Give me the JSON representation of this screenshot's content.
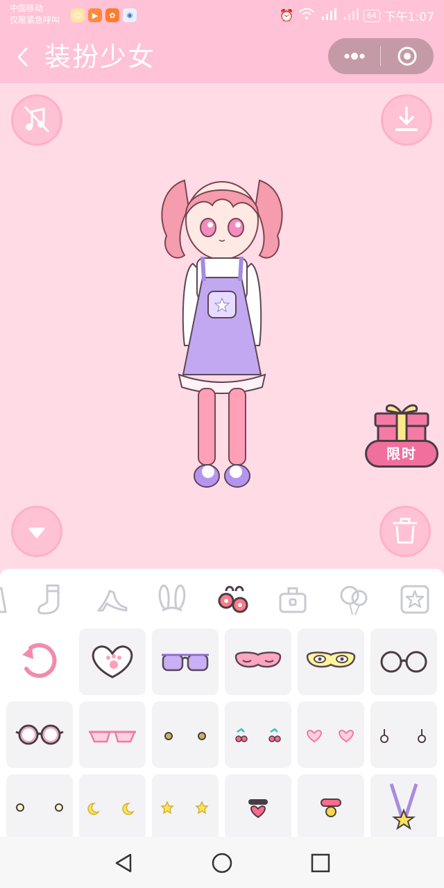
{
  "status_bar": {
    "carrier_line1": "中国移动",
    "carrier_line2": "仅限紧急呼叫",
    "battery": "64",
    "time": "下午1:07",
    "icons": [
      "alarm-icon",
      "wifi-icon",
      "signal-4g-icon",
      "signal-icon",
      "battery-icon"
    ]
  },
  "nav": {
    "title": "装扮少女",
    "back_icon": "chevron-left-icon",
    "more_icon": "more-dots-icon",
    "close_icon": "target-icon"
  },
  "stage": {
    "music_icon": "music-off-icon",
    "download_icon": "download-icon",
    "collapse_icon": "triangle-down-icon",
    "trash_icon": "trash-icon",
    "gift_label": "限时"
  },
  "categories": [
    {
      "icon": "dress-icon",
      "selected": false
    },
    {
      "icon": "sock-icon",
      "selected": false
    },
    {
      "icon": "high-heel-icon",
      "selected": false
    },
    {
      "icon": "bunny-ears-icon",
      "selected": false
    },
    {
      "icon": "earrings-icon",
      "selected": true
    },
    {
      "icon": "bag-icon",
      "selected": false
    },
    {
      "icon": "balloons-icon",
      "selected": false
    },
    {
      "icon": "star-frame-icon",
      "selected": false
    }
  ],
  "items": [
    {
      "icon": "reset-icon"
    },
    {
      "icon": "heart-paw-icon"
    },
    {
      "icon": "purple-sunglasses-icon"
    },
    {
      "icon": "pink-sleep-mask-icon"
    },
    {
      "icon": "yellow-eye-mask-icon"
    },
    {
      "icon": "round-glasses-icon"
    },
    {
      "icon": "pink-round-glasses-icon"
    },
    {
      "icon": "pink-glasses-icon"
    },
    {
      "icon": "gold-stud-earrings-icon"
    },
    {
      "icon": "cherry-earrings-icon"
    },
    {
      "icon": "heart-earrings-icon"
    },
    {
      "icon": "drop-earrings-icon"
    },
    {
      "icon": "pearl-stud-earrings-icon"
    },
    {
      "icon": "moon-earrings-icon"
    },
    {
      "icon": "star-earrings-icon"
    },
    {
      "icon": "heart-choker-icon"
    },
    {
      "icon": "bell-choker-icon"
    },
    {
      "icon": "star-medal-icon"
    }
  ],
  "colors": {
    "accent": "#ffc2d6",
    "background": "#ffdbe6",
    "gift": "#f06f9c",
    "capsule": "#c59aa7"
  }
}
